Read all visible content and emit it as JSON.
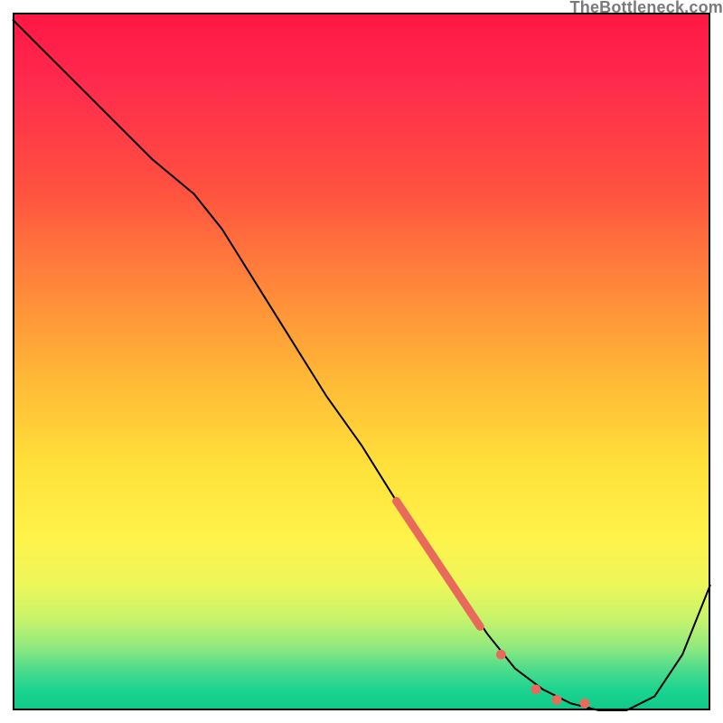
{
  "watermark": "TheBottleneck.com",
  "colors": {
    "curve": "#000000",
    "marker": "#e86a5b",
    "frame": "#000000"
  },
  "chart_data": {
    "type": "line",
    "title": "",
    "xlabel": "",
    "ylabel": "",
    "xlim": [
      0,
      100
    ],
    "ylim": [
      0,
      100
    ],
    "grid": false,
    "note": "No axis tick labels are visible in the image; values are normalized 0–100 estimates read from pixel positions.",
    "series": [
      {
        "name": "bottleneck-curve",
        "x": [
          0,
          3,
          8,
          14,
          20,
          26,
          30,
          35,
          40,
          45,
          50,
          55,
          60,
          64,
          68,
          72,
          76,
          80,
          84,
          88,
          92,
          96,
          100
        ],
        "y": [
          99,
          96,
          91,
          85,
          79,
          74,
          69,
          61,
          53,
          45,
          38,
          30,
          23,
          17,
          11,
          6,
          3,
          1,
          0,
          0,
          2,
          8,
          18
        ]
      }
    ],
    "markers": [
      {
        "name": "thick-segment",
        "type": "line-segment",
        "x": [
          55,
          67
        ],
        "y": [
          30,
          12
        ],
        "stroke_width_px": 9
      },
      {
        "name": "dot-a",
        "type": "point",
        "x": 70,
        "y": 8
      },
      {
        "name": "dot-b",
        "type": "point",
        "x": 75,
        "y": 3
      },
      {
        "name": "dot-c",
        "type": "point",
        "x": 78,
        "y": 1.5
      },
      {
        "name": "dot-d",
        "type": "point",
        "x": 82,
        "y": 1
      }
    ]
  }
}
